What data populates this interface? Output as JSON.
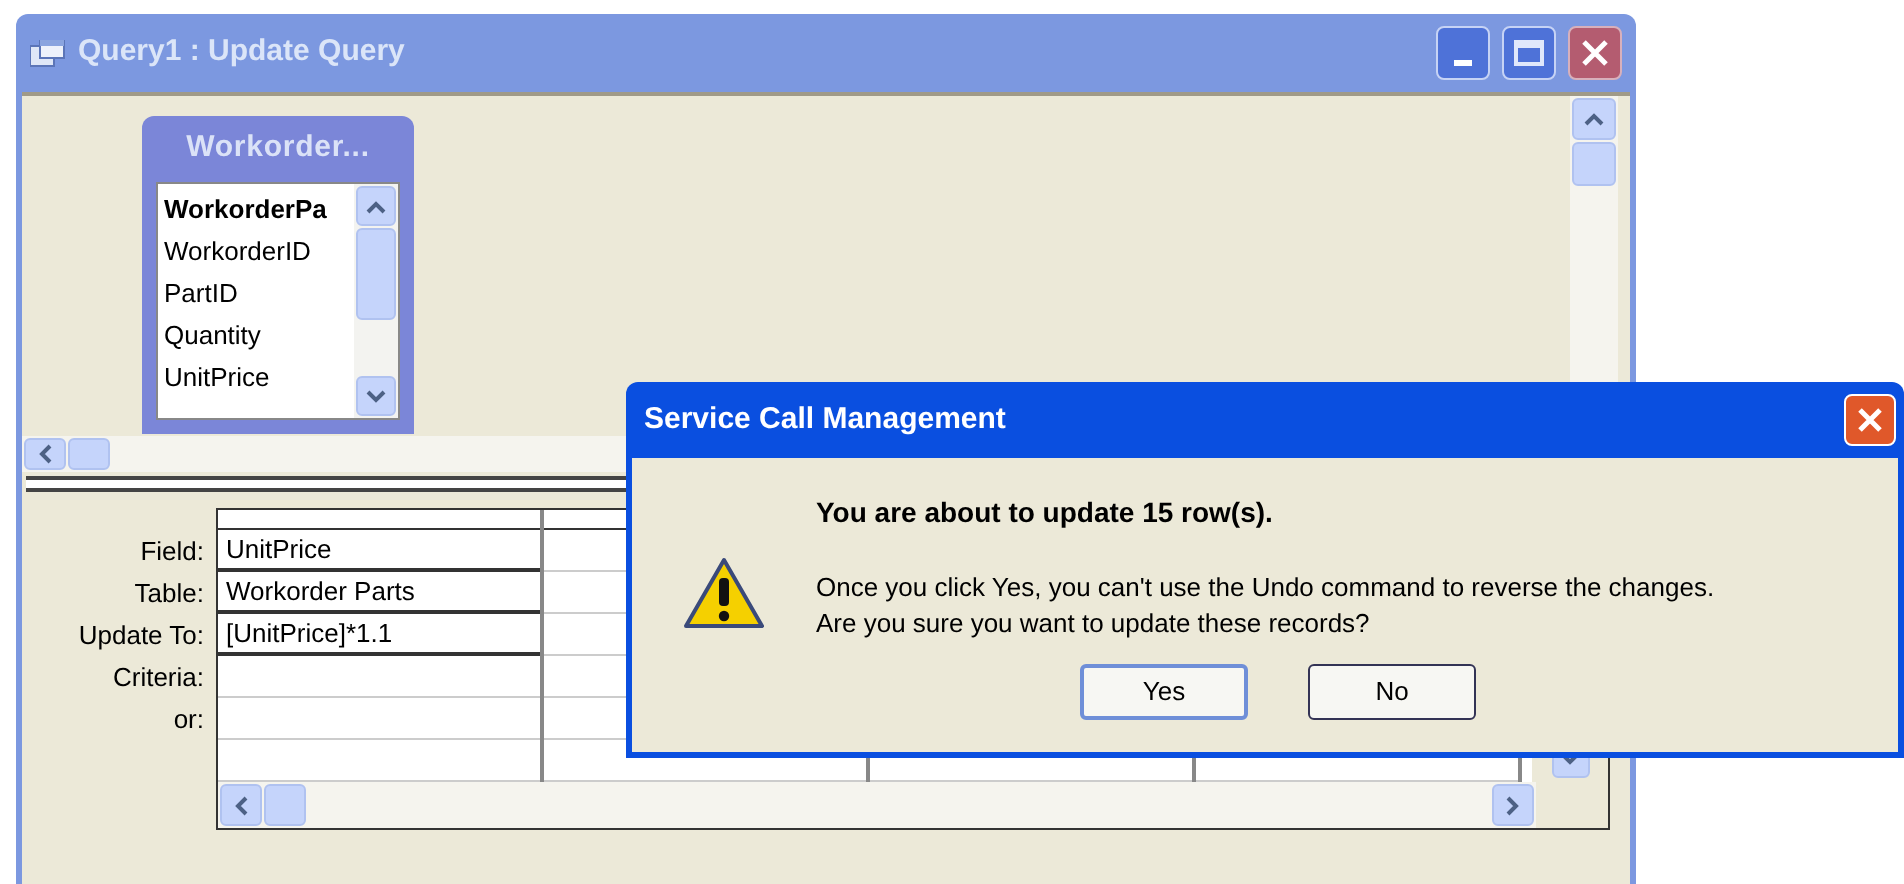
{
  "query_window": {
    "title": "Query1 : Update Query",
    "field_list": {
      "title": "Workorder...",
      "fields": [
        {
          "name": "WorkorderPa",
          "primary_key": true
        },
        {
          "name": "WorkorderID",
          "primary_key": false
        },
        {
          "name": "PartID",
          "primary_key": false
        },
        {
          "name": "Quantity",
          "primary_key": false
        },
        {
          "name": "UnitPrice",
          "primary_key": false
        }
      ]
    },
    "grid": {
      "row_labels": [
        "Field:",
        "Table:",
        "Update To:",
        "Criteria:",
        "or:"
      ],
      "columns": [
        {
          "field": "UnitPrice",
          "table": "Workorder Parts",
          "update_to": "[UnitPrice]*1.1"
        }
      ]
    }
  },
  "dialog": {
    "title": "Service Call Management",
    "heading": "You are about to update 15 row(s).",
    "message": [
      "Once you click Yes, you can't use the Undo command to reverse the changes.",
      "Are you sure you want to update these records?"
    ],
    "buttons": [
      "Yes",
      "No"
    ]
  }
}
